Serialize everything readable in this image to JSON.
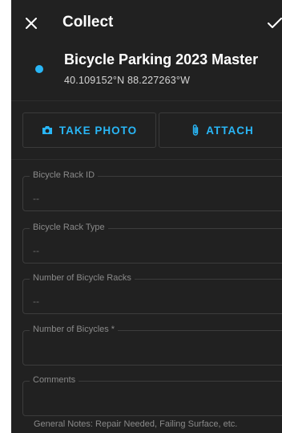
{
  "appbar": {
    "title": "Collect",
    "close_icon": "close-icon",
    "confirm_icon": "check-icon"
  },
  "header": {
    "layer_name": "Bicycle Parking 2023 Master",
    "coordinates": "40.109152°N  88.227263°W",
    "dot_color": "#29b6f6"
  },
  "actions": {
    "take_photo_label": "TAKE PHOTO",
    "take_photo_icon": "camera-icon",
    "attach_label": "ATTACH",
    "attach_icon": "paperclip-icon",
    "accent_color": "#29b6f6"
  },
  "fields": [
    {
      "label": "Bicycle Rack ID",
      "value": "--"
    },
    {
      "label": "Bicycle Rack Type",
      "value": "--"
    },
    {
      "label": "Number of Bicycle Racks",
      "value": "--"
    },
    {
      "label": "Number of Bicycles *",
      "value": ""
    },
    {
      "label": "Comments",
      "value": ""
    }
  ],
  "comments_hint": "General Notes: Repair Needed, Failing Surface, etc."
}
